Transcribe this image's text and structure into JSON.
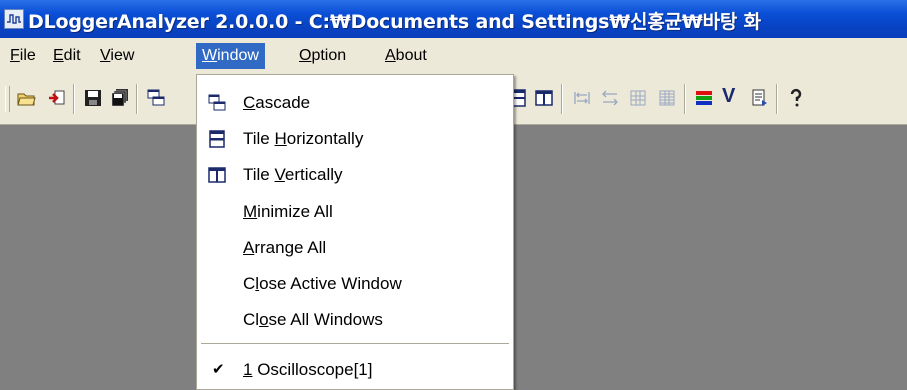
{
  "window": {
    "title": "DLoggerAnalyzer 2.0.0.0 - C:₩Documents and Settings₩신홍균₩바탕 화"
  },
  "menubar": {
    "items": [
      {
        "pre": "",
        "ul": "F",
        "post": "ile"
      },
      {
        "pre": "",
        "ul": "E",
        "post": "dit"
      },
      {
        "pre": "",
        "ul": "V",
        "post": "iew"
      },
      {
        "pre": "",
        "ul": "W",
        "post": "indow"
      },
      {
        "pre": "",
        "ul": "O",
        "post": "ption"
      },
      {
        "pre": "",
        "ul": "A",
        "post": "bout"
      }
    ]
  },
  "toolbar": {
    "v_label": "V",
    "icons": [
      "open-folder-icon",
      "import-icon",
      "save-icon",
      "save-all-icon",
      "tile-horizontal-icon",
      "tile-vertical-icon",
      "zoom-x-icon",
      "zoom-xy-icon",
      "grid-icon",
      "grid-fine-icon",
      "color-bars-icon",
      "v-cursor-icon",
      "export-icon",
      "help-icon"
    ]
  },
  "window_menu": {
    "items": [
      {
        "pre": "",
        "ul": "C",
        "post": "ascade",
        "icon": "cascade-icon"
      },
      {
        "pre": "Tile ",
        "ul": "H",
        "post": "orizontally",
        "icon": "tile-horizontal-icon"
      },
      {
        "pre": "Tile ",
        "ul": "V",
        "post": "ertically",
        "icon": "tile-vertical-icon"
      },
      {
        "pre": "",
        "ul": "M",
        "post": "inimize All"
      },
      {
        "pre": "",
        "ul": "A",
        "post": "rrange All"
      },
      {
        "pre": "C",
        "ul": "l",
        "post": "ose Active Window"
      },
      {
        "pre": "Cl",
        "ul": "o",
        "post": "se All Windows"
      }
    ],
    "window_list": [
      {
        "pre": "",
        "ul": "1",
        "post": " Oscilloscope[1]",
        "checked": true
      }
    ],
    "check_glyph": "✔"
  }
}
